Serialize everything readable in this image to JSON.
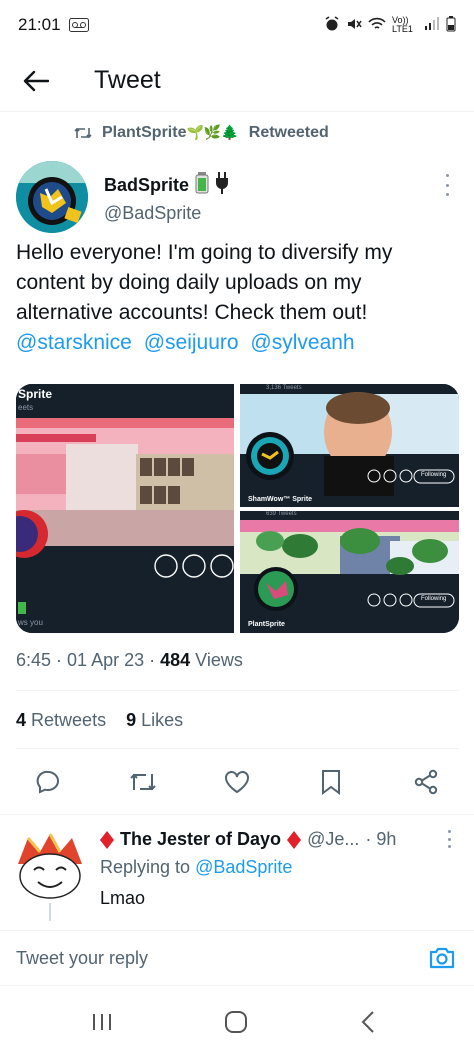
{
  "status_bar": {
    "time": "21:01",
    "network": "Vo)) LTE1"
  },
  "header": {
    "title": "Tweet"
  },
  "retweet": {
    "name": "PlantSprite",
    "emoji": "🌱🌿🌲",
    "label": "Retweeted"
  },
  "author": {
    "name": "BadSprite",
    "handle": "@BadSprite"
  },
  "tweet": {
    "lines": [
      "Hello everyone! I'm going to diversify my",
      "content by doing daily uploads on my",
      "alternative accounts! Check them out!"
    ],
    "mentions": [
      "@starsknice",
      "@seijuuro",
      "@sylveanh"
    ]
  },
  "media": {
    "m1": {
      "name_fragment": "Sprite",
      "sub_fragment": "eets",
      "bottom_fragment": "ws you"
    },
    "m2": {
      "tweets_label": "3,136 Tweets",
      "name": "ShamWow™ Sprite",
      "follow_label": "Following"
    },
    "m3": {
      "tweets_label": "639 Tweets",
      "name": "PlantSprite",
      "follow_label": "Following"
    }
  },
  "meta": {
    "time": "6:45",
    "date": "01 Apr 23",
    "views_count": "484",
    "views_label": "Views"
  },
  "stats": {
    "retweets_count": "4",
    "retweets_label": "Retweets",
    "likes_count": "9",
    "likes_label": "Likes"
  },
  "reply": {
    "name": "The Jester of Dayo",
    "handle": "@Je...",
    "time": "· 9h",
    "replying_label": "Replying to",
    "replying_to": "@BadSprite",
    "text": "Lmao"
  },
  "compose": {
    "placeholder": "Tweet your reply"
  },
  "colors": {
    "accent": "#1d9bf0",
    "text": "#0f1419",
    "secondary": "#536471",
    "diamond": "#e0202a"
  }
}
